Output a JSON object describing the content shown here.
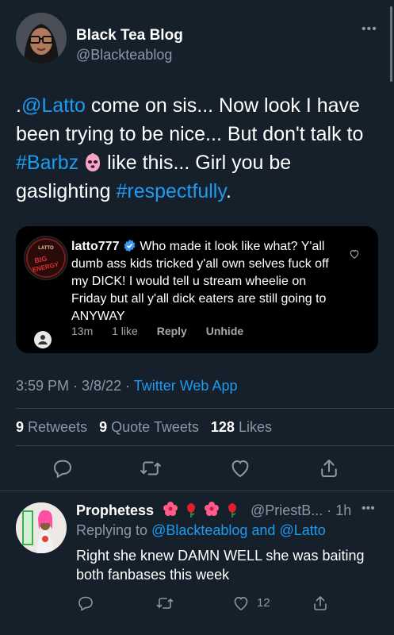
{
  "tweet": {
    "author_name": "Black Tea Blog",
    "author_handle": "@Blackteablog",
    "more_label": "•••",
    "body": {
      "prefix": ".",
      "mention": "@Latto",
      "part1": " come on sis... Now look I have been trying to be nice... But don't talk to ",
      "hashtag1": "#Barbz",
      "part2": " like this... Girl you be gaslighting ",
      "hashtag2": "#respectfully",
      "suffix": "."
    },
    "timestamp": "3:59 PM · 3/8/22 · ",
    "source": "Twitter Web App",
    "stats": {
      "retweets_count": "9",
      "retweets_label": "Retweets",
      "quotes_count": "9",
      "quotes_label": "Quote Tweets",
      "likes_count": "128",
      "likes_label": "Likes"
    }
  },
  "embedded_comment": {
    "avatar_text": "LATTO BIG ENERGY",
    "username": "latto777",
    "text": "Who made it look like what? Y'all dumb ass kids tricked y'all own selves fuck off my DICK! I would tell u stream wheelie on Friday but all y'all dick eaters are still going to ANYWAY",
    "time": "13m",
    "likes": "1 like",
    "reply_label": "Reply",
    "unhide_label": "Unhide"
  },
  "reply": {
    "author_name": "Prophetess",
    "flowers": "🌺🌹🌺🌹",
    "handle_time": "@PriestB... · 1h",
    "more_label": "•••",
    "replying_prefix": "Replying to ",
    "replying_to_1": "@Blackteablog",
    "replying_and": " and ",
    "replying_to_2": "@Latto",
    "text": "Right she knew DAMN WELL she was baiting both fanbases  this week",
    "like_count": "12"
  },
  "colors": {
    "background": "#15202b",
    "accent": "#1d9bf0",
    "secondary_text": "#8b98a5",
    "divider": "#38444d"
  },
  "icons": [
    "reply-icon",
    "retweet-icon",
    "like-icon",
    "share-icon",
    "verified-icon",
    "more-icon"
  ]
}
